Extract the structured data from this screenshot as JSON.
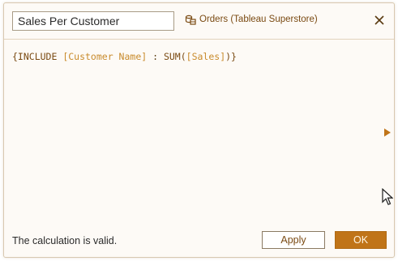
{
  "header": {
    "calc_name": "Sales Per Customer",
    "datasource_label": "Orders (Tableau Superstore)",
    "datasource_icon": "datasource-icon",
    "close_icon": "close-icon"
  },
  "editor": {
    "tokens": [
      {
        "text": "{INCLUDE ",
        "kind": "func"
      },
      {
        "text": "[Customer Name]",
        "kind": "field"
      },
      {
        "text": " : ",
        "kind": "op"
      },
      {
        "text": "SUM(",
        "kind": "func"
      },
      {
        "text": "[Sales]",
        "kind": "field"
      },
      {
        "text": ")}",
        "kind": "func"
      }
    ]
  },
  "footer": {
    "status": "The calculation is valid.",
    "apply_label": "Apply",
    "ok_label": "OK"
  },
  "colors": {
    "accent": "#c07418",
    "function": "#7a4a12",
    "field": "#c98b2c",
    "background": "#fdfaf6"
  }
}
